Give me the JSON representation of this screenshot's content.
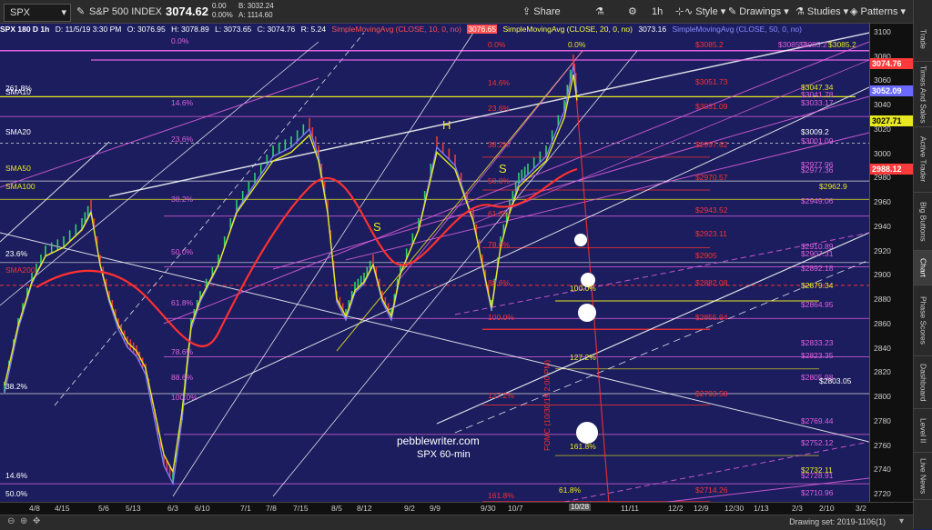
{
  "topbar": {
    "symbol": "SPX",
    "index_name": "S&P 500 INDEX",
    "price": "3074.62",
    "change_top": "0.00",
    "change_bottom": "0.00%",
    "bid_label": "B: 3032.24",
    "ask_label": "A: 1114.60",
    "share": "Share",
    "timeframe": "1h",
    "style": "Style",
    "drawings": "Drawings",
    "studies": "Studies",
    "patterns": "Patterns"
  },
  "infobar": {
    "title": "SPX 180 D 1h",
    "date": "D: 11/5/19 3:30 PM",
    "open": "O: 3076.95",
    "high": "H: 3078.89",
    "low": "L: 3073.65",
    "close": "C: 3074.76",
    "range": "R: 5.24",
    "sma10": "SimpleMovingAvg (CLOSE, 10, 0, no)",
    "sma10_val": "3076.65",
    "sma20": "SimpleMovingAvg (CLOSE, 20, 0, no)",
    "sma20_val": "3073.16",
    "sma50": "SimpleMovingAvg (CLOSE, 50, 0, no)"
  },
  "y_axis": {
    "ticks": [
      "3100",
      "3080",
      "3060",
      "3040",
      "3020",
      "3000",
      "2980",
      "2960",
      "2940",
      "2920",
      "2900",
      "2880",
      "2860",
      "2840",
      "2820",
      "2800",
      "2780",
      "2760",
      "2740",
      "2720"
    ],
    "tag_red_1": "3074.76",
    "tag_blue": "3052.09",
    "tag_yellow": "3027.71",
    "tag_red_2": "2988.12"
  },
  "x_axis": {
    "ticks": [
      "4/8",
      "4/15",
      "5/6",
      "5/13",
      "6/3",
      "6/10",
      "7/1",
      "7/8",
      "7/15",
      "8/5",
      "8/12",
      "9/2",
      "9/9",
      "9/30",
      "10/7",
      "10/28",
      "11/11",
      "12/2",
      "12/9",
      "12/30",
      "1/13",
      "2/3",
      "2/10",
      "3/2"
    ],
    "highlight": "10/28"
  },
  "status": {
    "drawing_set": "Drawing set: 2019-1106(1)"
  },
  "side_tabs": [
    "Trade",
    "Times And Sales",
    "Active Trader",
    "Big Buttons",
    "Chart",
    "Phase Scores",
    "Dashboard",
    "Level II",
    "Live News"
  ],
  "chart_labels": {
    "fib_left": [
      "0.0%",
      "14.6%",
      "23.6%",
      "38.2%",
      "50.0%",
      "61.8%",
      "78.6%",
      "88.6%",
      "100.0%"
    ],
    "fib_far_left": [
      "261.8%",
      "23.6%",
      "38.2%",
      "14.6%",
      "50.0%"
    ],
    "fib_mid": [
      "0.0%",
      "14.6%",
      "23.6%",
      "38.2%",
      "50.0%",
      "61.8%",
      "78.6%",
      "88.6%",
      "100.0%",
      "127.2%",
      "161.8%"
    ],
    "fib_right": [
      "0.0%",
      "100.0%",
      "127.2%",
      "161.8%",
      "61.8%"
    ],
    "sma_labels": [
      "SMA10",
      "SMA20",
      "SMA50",
      "SMA100",
      "SMA200"
    ],
    "right_values": [
      "$3085.2",
      "$3085.2",
      "$3085.2",
      "$3085.2",
      "$3047.34",
      "$3041.78",
      "$3051.73",
      "$3033.17",
      "$3031.09",
      "$3009.2",
      "$3001.09",
      "$2997.62",
      "$2977.96",
      "$2977.36",
      "$2970.57",
      "$2962.9",
      "$2949.06",
      "$2943.52",
      "$2923.11",
      "$2910.89",
      "$2907.31",
      "$2905",
      "$2892.18",
      "$2882.08",
      "$2879.34",
      "$2864.95",
      "$2855.94",
      "$2833.23",
      "$2823.35",
      "$2805.98",
      "$2803.05",
      "$2793.58",
      "$2769.44",
      "$2752.12",
      "$2732.11",
      "$2728.91",
      "$2714.26",
      "$2710.96"
    ],
    "pattern": [
      "S",
      "H",
      "S"
    ],
    "watermark_1": "pebblewriter.com",
    "watermark_2": "SPX 60-min",
    "fomc": "FOMC (10/30/19 2:00 PM)"
  },
  "colors": {
    "background": "#1b1d5e",
    "magenta": "#e060e0",
    "red": "#ff3030",
    "yellow": "#e8e820",
    "blue": "#6a6aff",
    "white": "#ffffff"
  }
}
